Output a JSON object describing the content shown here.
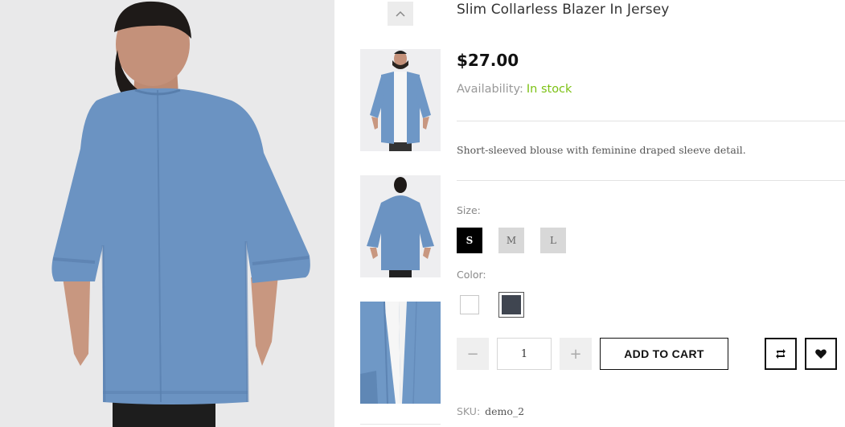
{
  "product": {
    "title": "Slim Collarless Blazer In Jersey",
    "price": "$27.00",
    "availability_label": "Availability:",
    "availability_value": "In stock",
    "description": "Short-sleeved blouse with feminine draped sleeve detail.",
    "sku_label": "SKU:",
    "sku_value": "demo_2"
  },
  "options": {
    "size_label": "Size:",
    "sizes": [
      "S",
      "M",
      "L"
    ],
    "selected_size": "S",
    "color_label": "Color:",
    "colors": [
      "#ffffff",
      "#3f4550"
    ],
    "selected_color": "#3f4550"
  },
  "cart": {
    "quantity": "1",
    "minus": "−",
    "plus": "+",
    "add_label": "ADD TO CART"
  },
  "icons": {
    "thumb_up": "chevron-up-icon",
    "compare": "compare-icon",
    "wishlist": "heart-icon"
  },
  "colors": {
    "in_stock": "#7cc114",
    "denim": "#6b93c2",
    "accent": "#000000"
  }
}
